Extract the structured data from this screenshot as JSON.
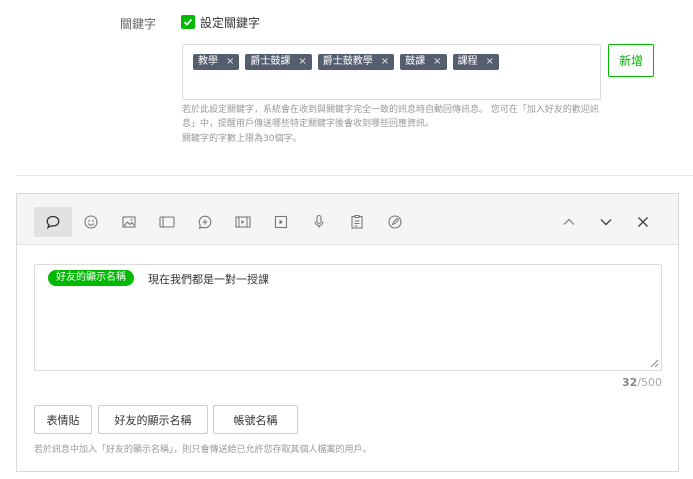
{
  "keyword": {
    "label": "關鍵字",
    "checkbox_label": "設定關鍵字",
    "tags": [
      {
        "label": "教學"
      },
      {
        "label": "爵士鼓課"
      },
      {
        "label": "爵士鼓教學"
      },
      {
        "label": "鼓課"
      },
      {
        "label": "課程"
      }
    ],
    "tag_remove": "×",
    "add_button": "新增",
    "hint_lines": [
      "若於此設定關鍵字，系統會在收到與關鍵字完全一致的訊息時自動回傳訊息。 您可在「加入好友的歡迎訊",
      "息」中，提醒用戶傳送哪些特定關鍵字後會收到哪些回應資訊。",
      "關鍵字的字數上限為30個字。"
    ]
  },
  "editor": {
    "toolbar": [
      {
        "icon": "speech-bubble-icon",
        "active": true
      },
      {
        "icon": "emoji-icon"
      },
      {
        "icon": "image-icon"
      },
      {
        "icon": "card-icon"
      },
      {
        "icon": "sticker-icon"
      },
      {
        "icon": "video-icon"
      },
      {
        "icon": "play-icon"
      },
      {
        "icon": "microphone-icon"
      },
      {
        "icon": "clipboard-icon"
      },
      {
        "icon": "pen-icon"
      },
      {
        "icon": "chevron-up-icon"
      },
      {
        "icon": "chevron-down-icon"
      },
      {
        "icon": "close-icon"
      }
    ],
    "name_chip": "好友的顯示名稱",
    "message": "現在我們都是一對一授課",
    "char_count": "32",
    "char_limit": "/500",
    "buttons": {
      "emoji": "表情貼",
      "friend_name": "好友的顯示名稱",
      "account_name": "帳號名稱"
    },
    "footnote": "若於訊息中加入「好友的顯示名稱」，則只會傳送給已允許您存取其個人檔案的用戶。"
  }
}
